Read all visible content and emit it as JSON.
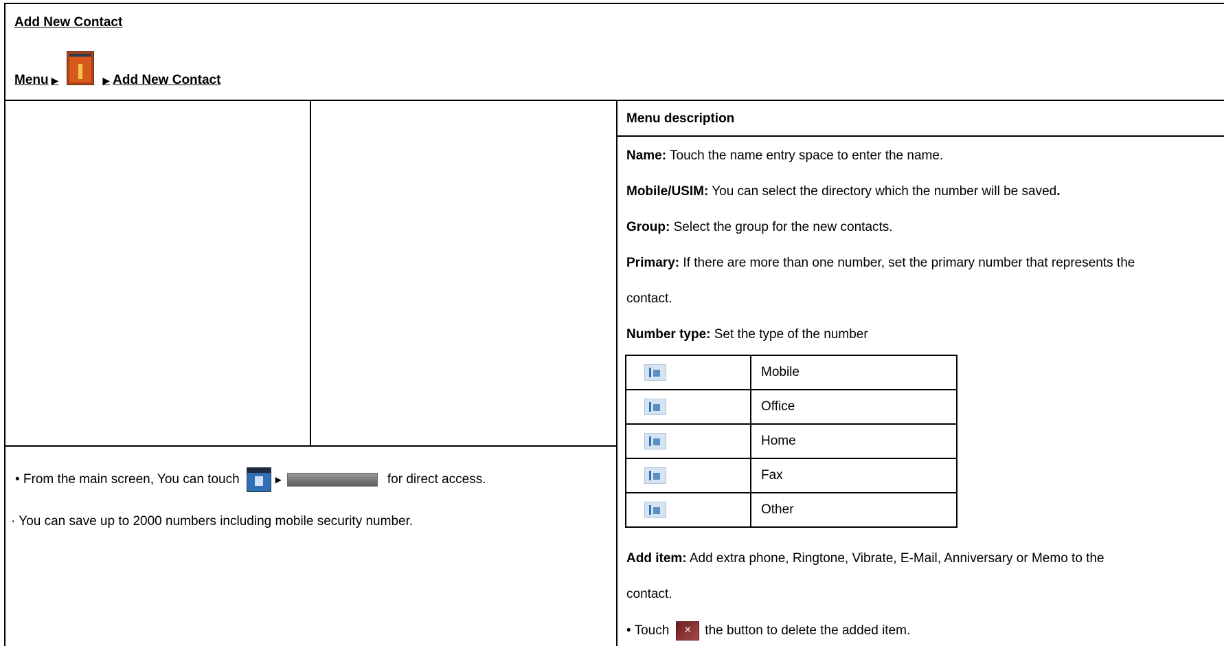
{
  "header": {
    "title": "Add New Contact",
    "breadcrumb": {
      "menu": "Menu",
      "separator": "▶",
      "target": "Add New Contact",
      "icon": "contacts-app-icon"
    }
  },
  "left": {
    "note1": {
      "before": "• From the main screen, You can touch",
      "after": "for direct access.",
      "icons": [
        "contacts-icon",
        "new-contact-button"
      ]
    },
    "note2": "·  You can save up to 2000 numbers including mobile security number."
  },
  "right": {
    "heading": "Menu description",
    "name": {
      "label": "Name:",
      "text": " Touch the name entry space to enter the name."
    },
    "mobile_usim": {
      "label": "Mobile/USIM:",
      "text": " You can select the directory which the number will be saved",
      "end": "."
    },
    "group": {
      "label": "Group:",
      "text": " Select the group for the new contacts."
    },
    "primary": {
      "label": "Primary:",
      "text": " If there are more than one number, set the primary number that represents the",
      "cont": "contact."
    },
    "number_type": {
      "label": "Number type:",
      "text": " Set the type of the number"
    },
    "types": [
      "Mobile",
      "Office",
      "Home",
      "Fax",
      "Other"
    ],
    "add_item": {
      "label": "Add item:",
      "text": " Add extra phone, Ringtone, Vibrate, E-Mail, Anniversary or Memo to the",
      "cont": "contact."
    },
    "touch_note": {
      "before": "•  Touch",
      "after": "the button to delete the added item.",
      "icon": "delete-icon"
    }
  }
}
